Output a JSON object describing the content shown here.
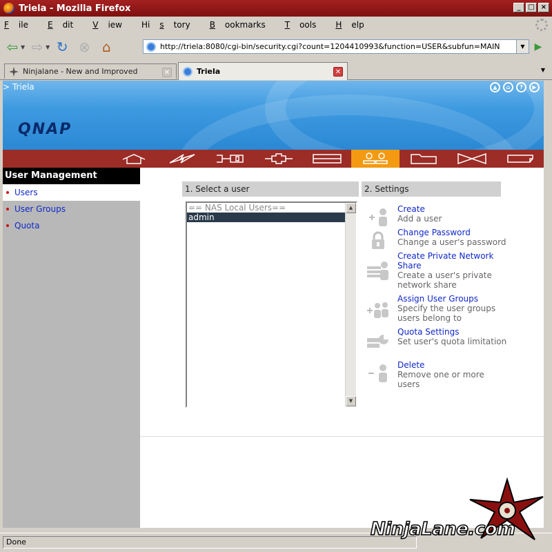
{
  "window": {
    "title": "Triela - Mozilla Firefox",
    "buttons": {
      "minimize": "_",
      "maximize": "□",
      "close": "×"
    }
  },
  "menu": {
    "items": [
      {
        "u": "F",
        "rest": "ile"
      },
      {
        "u": "E",
        "rest": "dit"
      },
      {
        "u": "V",
        "rest": "iew"
      },
      {
        "u": "",
        "rest": "Hi",
        "u2": "s",
        "rest2": "tory"
      },
      {
        "u": "B",
        "rest": "ookmarks"
      },
      {
        "u": "T",
        "rest": "ools"
      },
      {
        "u": "H",
        "rest": "elp"
      }
    ]
  },
  "nav": {
    "url": "http://triela:8080/cgi-bin/security.cgi?count=1204410993&function=USER&subfun=MAIN"
  },
  "tabs": [
    {
      "label": "Ninjalane - New and Improved",
      "active": false
    },
    {
      "label": "Triela",
      "active": true
    }
  ],
  "page": {
    "breadcrumb": "> Triela",
    "logo": "QNAP",
    "sidebar": {
      "heading": "User Management",
      "items": [
        "Users",
        "User Groups",
        "Quota"
      ]
    },
    "panel1": {
      "heading": "1. Select a user",
      "group": "== NAS Local Users==",
      "users": [
        "admin"
      ]
    },
    "panel2": {
      "heading": "2. Settings",
      "actions": [
        {
          "link": "Create",
          "desc": "Add a user"
        },
        {
          "link": "Change Password",
          "desc": "Change a user's password"
        },
        {
          "link": "Create Private Network Share",
          "desc": "Create a user's private network share"
        },
        {
          "link": "Assign User Groups",
          "desc": "Specify the user groups users belong to"
        },
        {
          "link": "Quota Settings",
          "desc": "Set user's quota limitation"
        },
        {
          "link": "Delete",
          "desc": "Remove one or more users"
        }
      ]
    }
  },
  "status": {
    "text": "Done"
  },
  "watermark": {
    "text": "NinjaLane.com"
  },
  "colors": {
    "titlebar": "#9c2020",
    "iconbar": "#9c2c26",
    "active_icon": "#f39a12",
    "link": "#1028c8"
  }
}
